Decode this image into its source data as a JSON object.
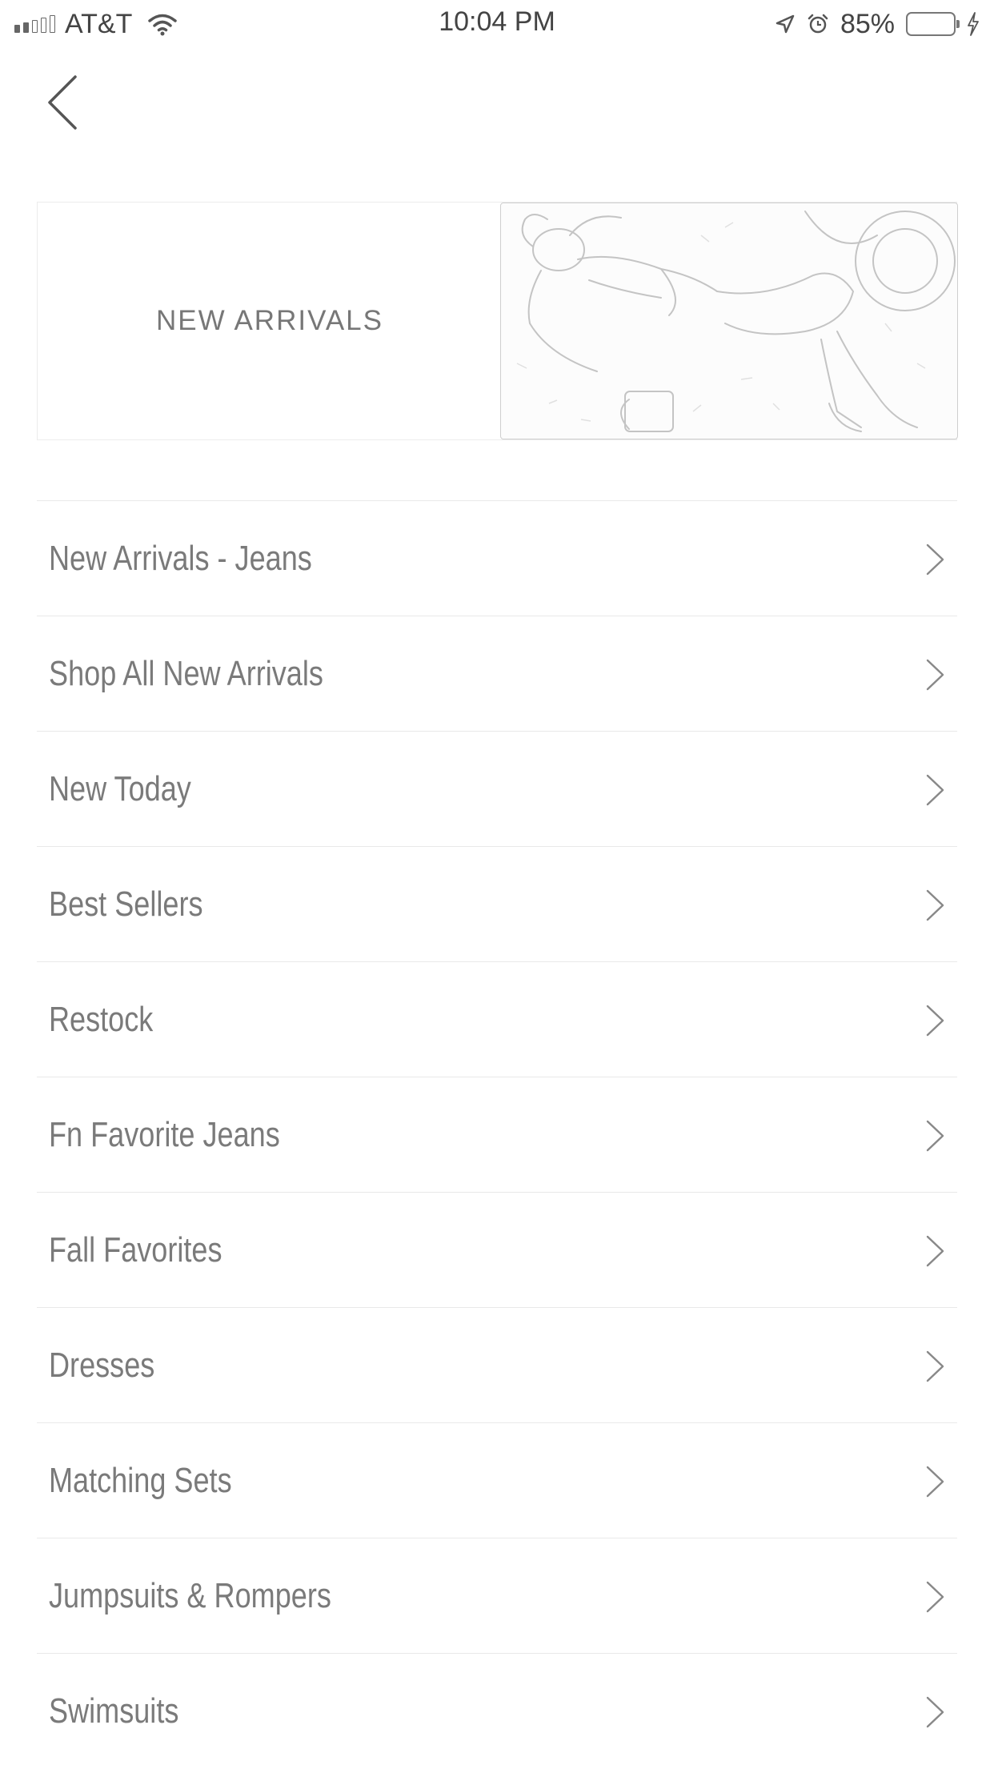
{
  "status_bar": {
    "carrier": "AT&T",
    "time": "10:04 PM",
    "battery_percent": "85%",
    "signal_bars_filled": 2,
    "signal_bars_total": 5,
    "battery_level": 0.85,
    "icons": [
      "wifi-icon",
      "location-arrow-icon",
      "alarm-icon",
      "battery-icon",
      "charging-bolt-icon"
    ]
  },
  "nav": {
    "back_icon": "chevron-left-icon"
  },
  "banner": {
    "title": "NEW ARRIVALS"
  },
  "menu": {
    "chevron_icon": "chevron-right-icon",
    "items": [
      {
        "label": "New Arrivals - Jeans"
      },
      {
        "label": "Shop All New Arrivals"
      },
      {
        "label": "New Today"
      },
      {
        "label": "Best Sellers"
      },
      {
        "label": "Restock"
      },
      {
        "label": "Fn Favorite Jeans"
      },
      {
        "label": "Fall Favorites"
      },
      {
        "label": "Dresses"
      },
      {
        "label": "Matching Sets"
      },
      {
        "label": "Jumpsuits & Rompers"
      },
      {
        "label": "Swimsuits"
      }
    ]
  },
  "colors": {
    "background": "#ffffff",
    "text": "#7a7a7a",
    "divider": "#e9e9e9"
  }
}
